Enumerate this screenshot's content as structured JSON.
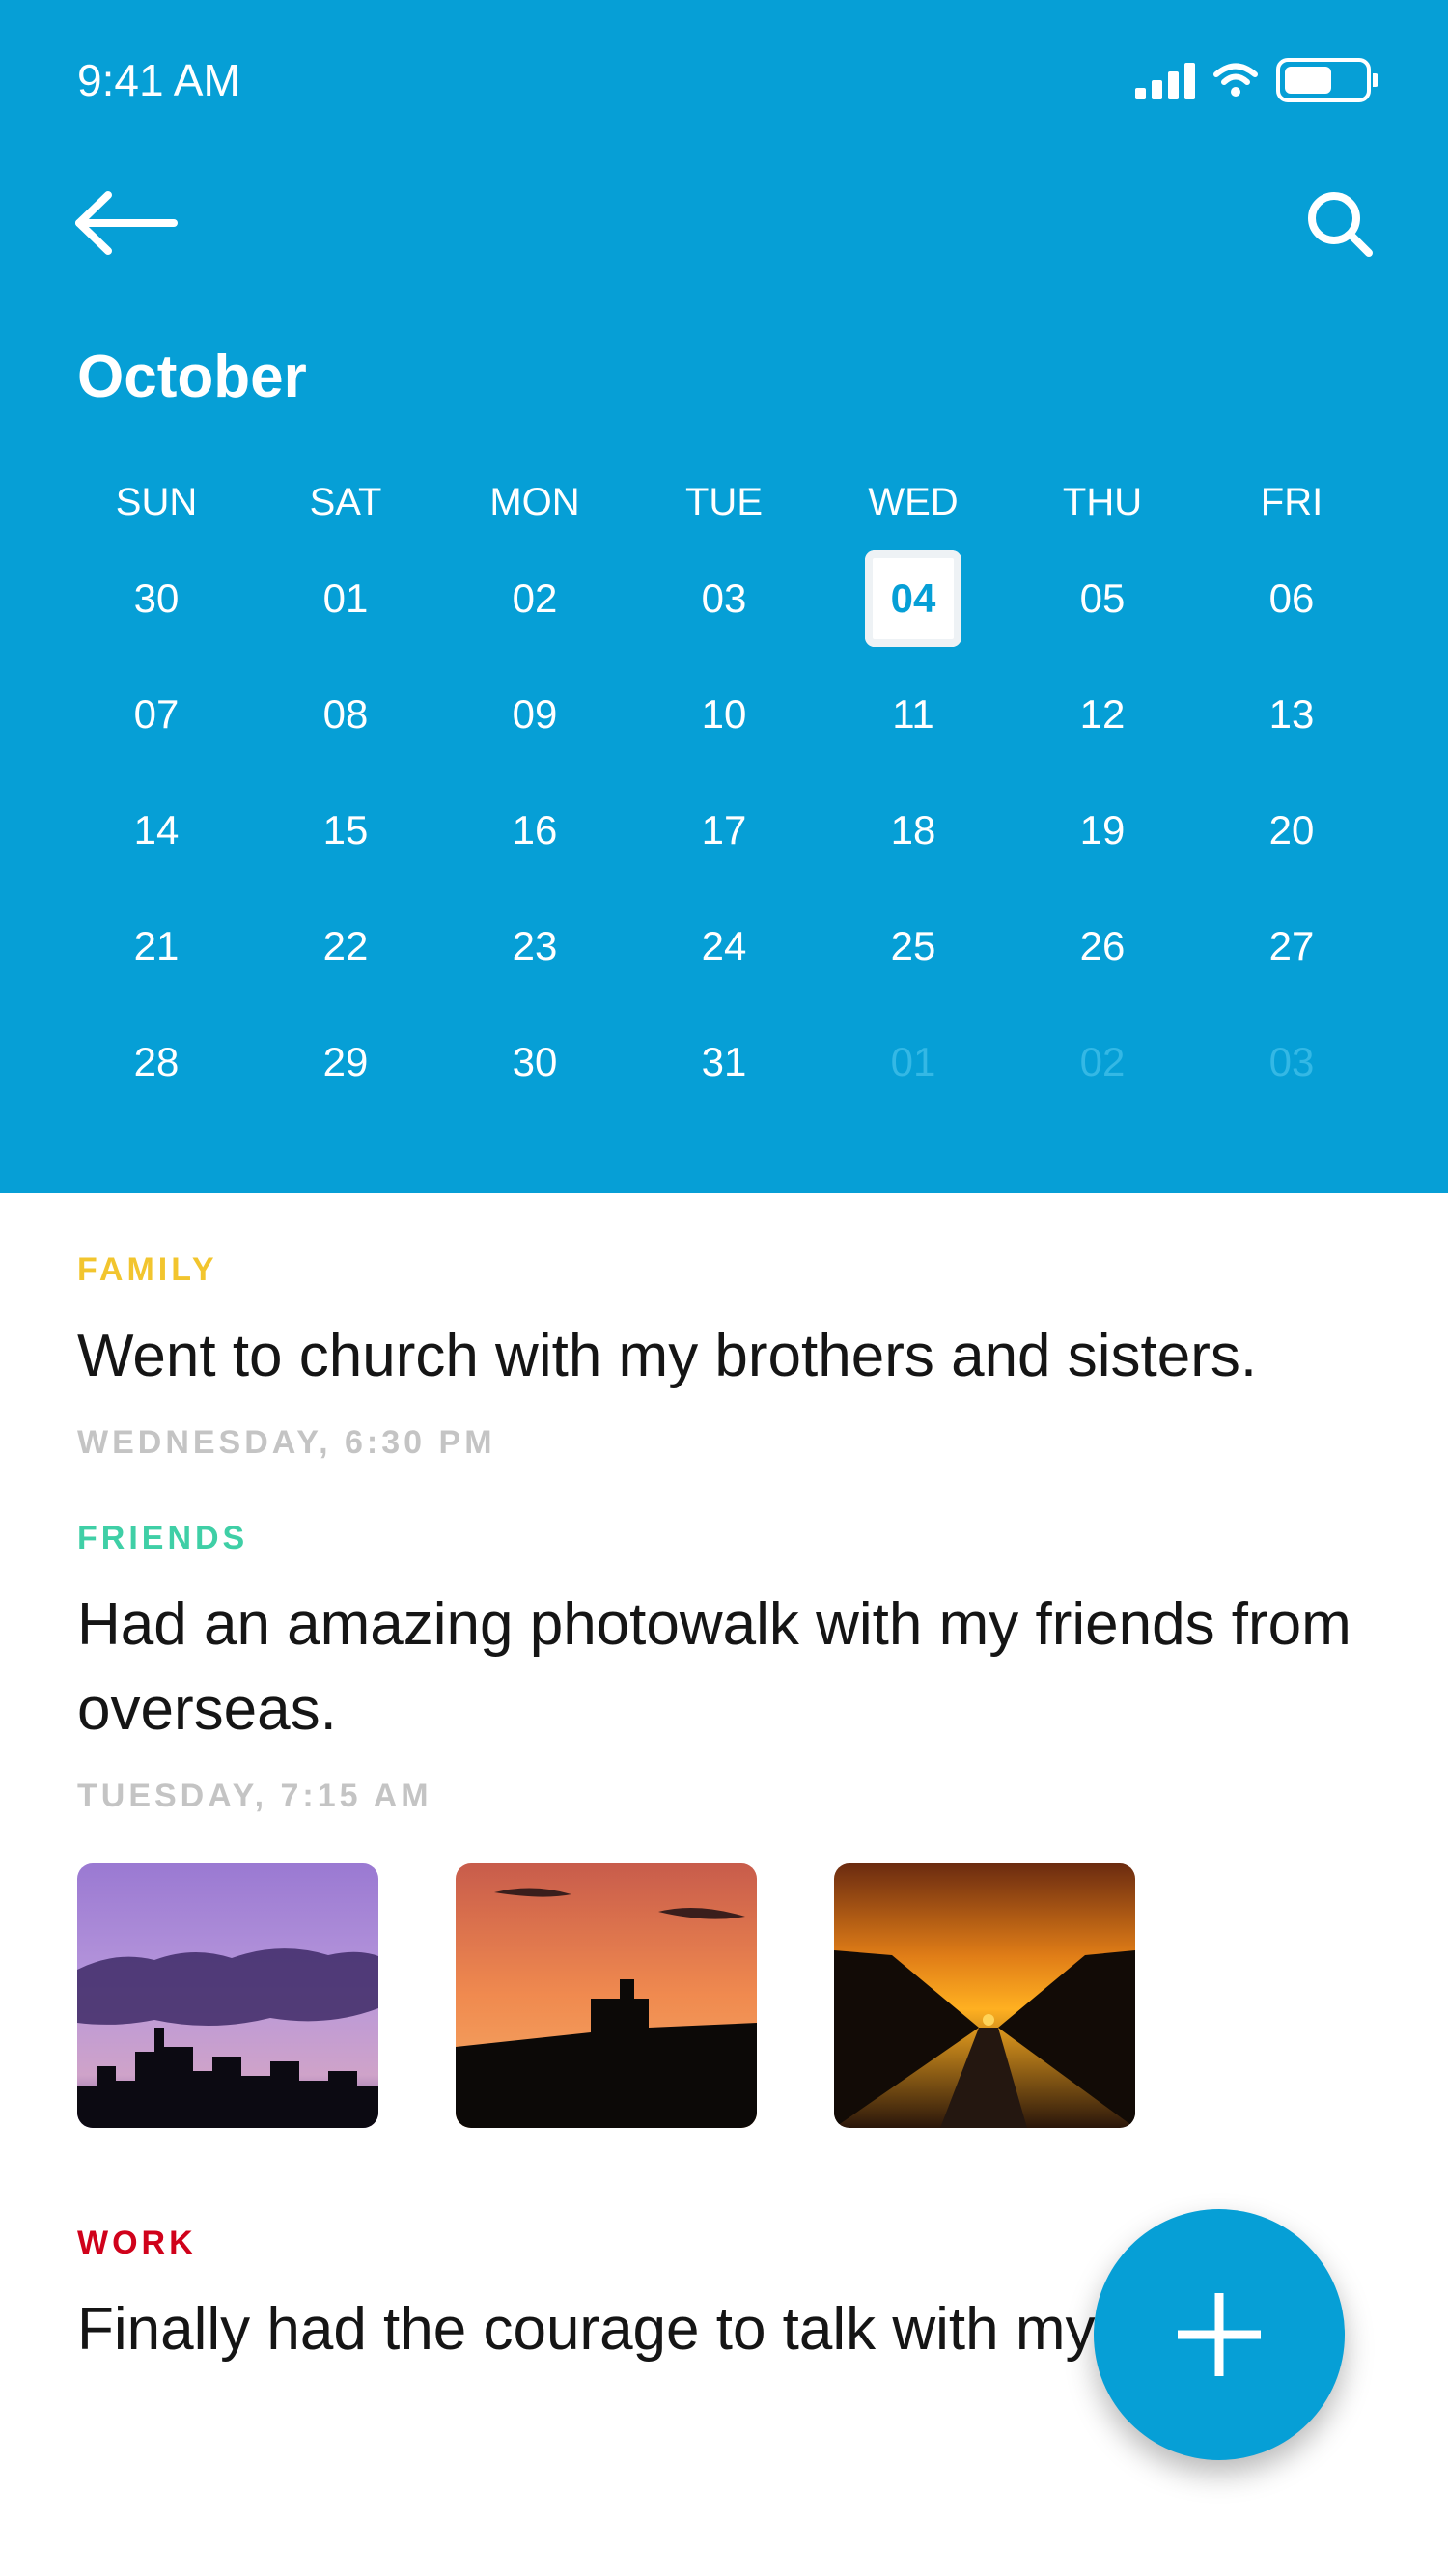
{
  "status": {
    "time": "9:41 AM",
    "battery_level": 0.6
  },
  "header": {
    "month": "October"
  },
  "calendar": {
    "weekdays": [
      "SUN",
      "SAT",
      "MON",
      "TUE",
      "WED",
      "THU",
      "FRI"
    ],
    "weeks": [
      [
        "30",
        "01",
        "02",
        "03",
        "04",
        "05",
        "06"
      ],
      [
        "07",
        "08",
        "09",
        "10",
        "11",
        "12",
        "13"
      ],
      [
        "14",
        "15",
        "16",
        "17",
        "18",
        "19",
        "20"
      ],
      [
        "21",
        "22",
        "23",
        "24",
        "25",
        "26",
        "27"
      ],
      [
        "28",
        "29",
        "30",
        "31",
        "01",
        "02",
        "03"
      ]
    ],
    "selected": "04",
    "next_month_days": [
      "01",
      "02",
      "03"
    ]
  },
  "entries": [
    {
      "category": "FAMILY",
      "category_color": "#f2c52e",
      "text": "Went to church with my brothers and sisters.",
      "time": "WEDNESDAY, 6:30 PM"
    },
    {
      "category": "FRIENDS",
      "category_color": "#3fcfa6",
      "text": "Had an amazing photowalk with my friends from overseas.",
      "time": "TUESDAY, 7:15 AM",
      "photos": [
        "purple sunset skyline",
        "orange sunset rooftop",
        "sunset street"
      ]
    },
    {
      "category": "WORK",
      "category_color": "#d0021b",
      "text": "Finally had the courage to talk with my boss"
    }
  ],
  "colors": {
    "primary": "#069fd6",
    "muted": "#c4c4c4",
    "other_month": "#34b8e5"
  }
}
